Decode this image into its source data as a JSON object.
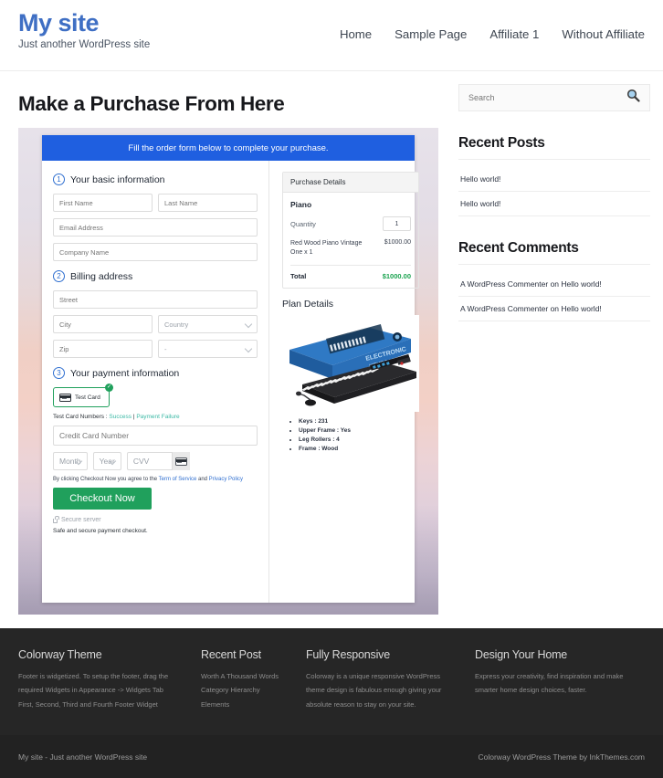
{
  "header": {
    "site_title": "My site",
    "tagline": "Just another WordPress site",
    "nav": [
      {
        "label": "Home"
      },
      {
        "label": "Sample Page"
      },
      {
        "label": "Affiliate 1"
      },
      {
        "label": "Without Affiliate"
      }
    ]
  },
  "main": {
    "page_title": "Make a Purchase From Here",
    "checkout": {
      "banner": "Fill the order form below to complete your purchase.",
      "steps": [
        {
          "num": "1",
          "label": "Your basic information"
        },
        {
          "num": "2",
          "label": "Billing address"
        },
        {
          "num": "3",
          "label": "Your payment information"
        }
      ],
      "fields": {
        "first_name": "First Name",
        "last_name": "Last Name",
        "email": "Email Address",
        "company": "Company Name",
        "street": "Street",
        "city": "City",
        "country": "Country",
        "zip": "Zip",
        "state": "-",
        "card_number": "Credit Card Number",
        "month": "Month",
        "year": "Year",
        "cvv": "CVV"
      },
      "payment_method": {
        "label": "Test Card",
        "icon": "credit-card-icon",
        "selected_mark": "✓"
      },
      "test_cards": {
        "prefix": "Test Card Numbers : ",
        "success": "Success",
        "separator": " | ",
        "failure": "Payment Failure"
      },
      "terms": {
        "prefix": "By clicking Checkout Now you agree to the ",
        "tos": "Term of Service",
        "middle": " and ",
        "privacy": "Privacy Policy"
      },
      "checkout_button": "Checkout Now",
      "secure_server": "Secure server",
      "secure_note": "Safe and secure payment checkout.",
      "accent_blue": "#1f5fe0",
      "accent_green": "#20a05c"
    },
    "summary": {
      "heading": "Purchase Details",
      "product": "Piano",
      "quantity_label": "Quantity",
      "quantity_value": "1",
      "line_item_desc": "Red Wood Piano Vintage One x 1",
      "line_item_price": "$1000.00",
      "total_label": "Total",
      "total_value": "$1000.00",
      "total_color": "#1aa34f"
    },
    "plan": {
      "title": "Plan Details",
      "image_alt": "electronic-keyboard-product-photo",
      "features": [
        "Keys : 231",
        "Upper Frame : Yes",
        "Leg Rollers : 4",
        "Frame : Wood"
      ]
    }
  },
  "sidebar": {
    "search": {
      "placeholder": "Search",
      "icon": "search-icon"
    },
    "recent_posts": {
      "title": "Recent Posts",
      "items": [
        {
          "label": "Hello world!"
        },
        {
          "label": "Hello world!"
        }
      ]
    },
    "recent_comments": {
      "title": "Recent Comments",
      "items": [
        {
          "label": "A WordPress Commenter on Hello world!"
        },
        {
          "label": "A WordPress Commenter on Hello world!"
        }
      ]
    }
  },
  "footer": {
    "columns": [
      {
        "title": "Colorway Theme",
        "lines": [
          "Footer is widgetized. To setup the footer, drag the",
          "required Widgets in Appearance -> Widgets Tab",
          "First, Second, Third and Fourth Footer Widget"
        ]
      },
      {
        "title": "Recent Post",
        "lines": [
          "Worth A Thousand Words",
          "Category Hierarchy",
          "Elements"
        ]
      },
      {
        "title": "Fully Responsive",
        "lines": [
          "Colorway is a unique responsive WordPress",
          "theme design is fabulous enough giving your",
          "absolute reason to stay on your site."
        ]
      },
      {
        "title": "Design Your Home",
        "lines": [
          "Express your creativity, find inspiration and make",
          "smarter home design choices, faster."
        ]
      }
    ],
    "bottom_left": "My site - Just another WordPress site",
    "bottom_right": "Colorway WordPress Theme by InkThemes.com"
  }
}
